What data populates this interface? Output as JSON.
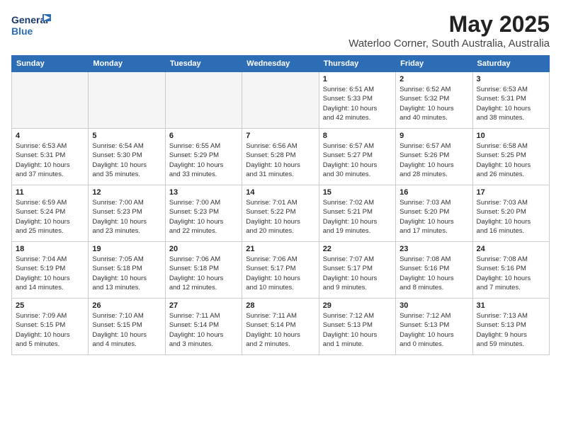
{
  "header": {
    "logo_line1": "General",
    "logo_line2": "Blue",
    "main_title": "May 2025",
    "subtitle": "Waterloo Corner, South Australia, Australia"
  },
  "calendar": {
    "day_headers": [
      "Sunday",
      "Monday",
      "Tuesday",
      "Wednesday",
      "Thursday",
      "Friday",
      "Saturday"
    ],
    "weeks": [
      [
        {
          "day": "",
          "info": ""
        },
        {
          "day": "",
          "info": ""
        },
        {
          "day": "",
          "info": ""
        },
        {
          "day": "",
          "info": ""
        },
        {
          "day": "1",
          "info": "Sunrise: 6:51 AM\nSunset: 5:33 PM\nDaylight: 10 hours\nand 42 minutes."
        },
        {
          "day": "2",
          "info": "Sunrise: 6:52 AM\nSunset: 5:32 PM\nDaylight: 10 hours\nand 40 minutes."
        },
        {
          "day": "3",
          "info": "Sunrise: 6:53 AM\nSunset: 5:31 PM\nDaylight: 10 hours\nand 38 minutes."
        }
      ],
      [
        {
          "day": "4",
          "info": "Sunrise: 6:53 AM\nSunset: 5:31 PM\nDaylight: 10 hours\nand 37 minutes."
        },
        {
          "day": "5",
          "info": "Sunrise: 6:54 AM\nSunset: 5:30 PM\nDaylight: 10 hours\nand 35 minutes."
        },
        {
          "day": "6",
          "info": "Sunrise: 6:55 AM\nSunset: 5:29 PM\nDaylight: 10 hours\nand 33 minutes."
        },
        {
          "day": "7",
          "info": "Sunrise: 6:56 AM\nSunset: 5:28 PM\nDaylight: 10 hours\nand 31 minutes."
        },
        {
          "day": "8",
          "info": "Sunrise: 6:57 AM\nSunset: 5:27 PM\nDaylight: 10 hours\nand 30 minutes."
        },
        {
          "day": "9",
          "info": "Sunrise: 6:57 AM\nSunset: 5:26 PM\nDaylight: 10 hours\nand 28 minutes."
        },
        {
          "day": "10",
          "info": "Sunrise: 6:58 AM\nSunset: 5:25 PM\nDaylight: 10 hours\nand 26 minutes."
        }
      ],
      [
        {
          "day": "11",
          "info": "Sunrise: 6:59 AM\nSunset: 5:24 PM\nDaylight: 10 hours\nand 25 minutes."
        },
        {
          "day": "12",
          "info": "Sunrise: 7:00 AM\nSunset: 5:23 PM\nDaylight: 10 hours\nand 23 minutes."
        },
        {
          "day": "13",
          "info": "Sunrise: 7:00 AM\nSunset: 5:23 PM\nDaylight: 10 hours\nand 22 minutes."
        },
        {
          "day": "14",
          "info": "Sunrise: 7:01 AM\nSunset: 5:22 PM\nDaylight: 10 hours\nand 20 minutes."
        },
        {
          "day": "15",
          "info": "Sunrise: 7:02 AM\nSunset: 5:21 PM\nDaylight: 10 hours\nand 19 minutes."
        },
        {
          "day": "16",
          "info": "Sunrise: 7:03 AM\nSunset: 5:20 PM\nDaylight: 10 hours\nand 17 minutes."
        },
        {
          "day": "17",
          "info": "Sunrise: 7:03 AM\nSunset: 5:20 PM\nDaylight: 10 hours\nand 16 minutes."
        }
      ],
      [
        {
          "day": "18",
          "info": "Sunrise: 7:04 AM\nSunset: 5:19 PM\nDaylight: 10 hours\nand 14 minutes."
        },
        {
          "day": "19",
          "info": "Sunrise: 7:05 AM\nSunset: 5:18 PM\nDaylight: 10 hours\nand 13 minutes."
        },
        {
          "day": "20",
          "info": "Sunrise: 7:06 AM\nSunset: 5:18 PM\nDaylight: 10 hours\nand 12 minutes."
        },
        {
          "day": "21",
          "info": "Sunrise: 7:06 AM\nSunset: 5:17 PM\nDaylight: 10 hours\nand 10 minutes."
        },
        {
          "day": "22",
          "info": "Sunrise: 7:07 AM\nSunset: 5:17 PM\nDaylight: 10 hours\nand 9 minutes."
        },
        {
          "day": "23",
          "info": "Sunrise: 7:08 AM\nSunset: 5:16 PM\nDaylight: 10 hours\nand 8 minutes."
        },
        {
          "day": "24",
          "info": "Sunrise: 7:08 AM\nSunset: 5:16 PM\nDaylight: 10 hours\nand 7 minutes."
        }
      ],
      [
        {
          "day": "25",
          "info": "Sunrise: 7:09 AM\nSunset: 5:15 PM\nDaylight: 10 hours\nand 5 minutes."
        },
        {
          "day": "26",
          "info": "Sunrise: 7:10 AM\nSunset: 5:15 PM\nDaylight: 10 hours\nand 4 minutes."
        },
        {
          "day": "27",
          "info": "Sunrise: 7:11 AM\nSunset: 5:14 PM\nDaylight: 10 hours\nand 3 minutes."
        },
        {
          "day": "28",
          "info": "Sunrise: 7:11 AM\nSunset: 5:14 PM\nDaylight: 10 hours\nand 2 minutes."
        },
        {
          "day": "29",
          "info": "Sunrise: 7:12 AM\nSunset: 5:13 PM\nDaylight: 10 hours\nand 1 minute."
        },
        {
          "day": "30",
          "info": "Sunrise: 7:12 AM\nSunset: 5:13 PM\nDaylight: 10 hours\nand 0 minutes."
        },
        {
          "day": "31",
          "info": "Sunrise: 7:13 AM\nSunset: 5:13 PM\nDaylight: 9 hours\nand 59 minutes."
        }
      ]
    ]
  }
}
